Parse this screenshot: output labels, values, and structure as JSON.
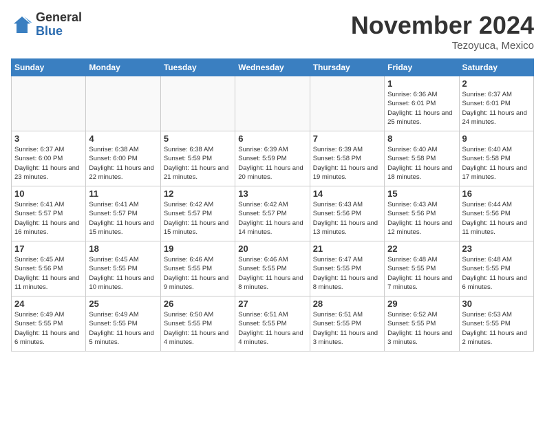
{
  "logo": {
    "general": "General",
    "blue": "Blue"
  },
  "title": "November 2024",
  "location": "Tezoyuca, Mexico",
  "weekdays": [
    "Sunday",
    "Monday",
    "Tuesday",
    "Wednesday",
    "Thursday",
    "Friday",
    "Saturday"
  ],
  "weeks": [
    [
      {
        "day": "",
        "info": ""
      },
      {
        "day": "",
        "info": ""
      },
      {
        "day": "",
        "info": ""
      },
      {
        "day": "",
        "info": ""
      },
      {
        "day": "",
        "info": ""
      },
      {
        "day": "1",
        "info": "Sunrise: 6:36 AM\nSunset: 6:01 PM\nDaylight: 11 hours and 25 minutes."
      },
      {
        "day": "2",
        "info": "Sunrise: 6:37 AM\nSunset: 6:01 PM\nDaylight: 11 hours and 24 minutes."
      }
    ],
    [
      {
        "day": "3",
        "info": "Sunrise: 6:37 AM\nSunset: 6:00 PM\nDaylight: 11 hours and 23 minutes."
      },
      {
        "day": "4",
        "info": "Sunrise: 6:38 AM\nSunset: 6:00 PM\nDaylight: 11 hours and 22 minutes."
      },
      {
        "day": "5",
        "info": "Sunrise: 6:38 AM\nSunset: 5:59 PM\nDaylight: 11 hours and 21 minutes."
      },
      {
        "day": "6",
        "info": "Sunrise: 6:39 AM\nSunset: 5:59 PM\nDaylight: 11 hours and 20 minutes."
      },
      {
        "day": "7",
        "info": "Sunrise: 6:39 AM\nSunset: 5:58 PM\nDaylight: 11 hours and 19 minutes."
      },
      {
        "day": "8",
        "info": "Sunrise: 6:40 AM\nSunset: 5:58 PM\nDaylight: 11 hours and 18 minutes."
      },
      {
        "day": "9",
        "info": "Sunrise: 6:40 AM\nSunset: 5:58 PM\nDaylight: 11 hours and 17 minutes."
      }
    ],
    [
      {
        "day": "10",
        "info": "Sunrise: 6:41 AM\nSunset: 5:57 PM\nDaylight: 11 hours and 16 minutes."
      },
      {
        "day": "11",
        "info": "Sunrise: 6:41 AM\nSunset: 5:57 PM\nDaylight: 11 hours and 15 minutes."
      },
      {
        "day": "12",
        "info": "Sunrise: 6:42 AM\nSunset: 5:57 PM\nDaylight: 11 hours and 15 minutes."
      },
      {
        "day": "13",
        "info": "Sunrise: 6:42 AM\nSunset: 5:57 PM\nDaylight: 11 hours and 14 minutes."
      },
      {
        "day": "14",
        "info": "Sunrise: 6:43 AM\nSunset: 5:56 PM\nDaylight: 11 hours and 13 minutes."
      },
      {
        "day": "15",
        "info": "Sunrise: 6:43 AM\nSunset: 5:56 PM\nDaylight: 11 hours and 12 minutes."
      },
      {
        "day": "16",
        "info": "Sunrise: 6:44 AM\nSunset: 5:56 PM\nDaylight: 11 hours and 11 minutes."
      }
    ],
    [
      {
        "day": "17",
        "info": "Sunrise: 6:45 AM\nSunset: 5:56 PM\nDaylight: 11 hours and 11 minutes."
      },
      {
        "day": "18",
        "info": "Sunrise: 6:45 AM\nSunset: 5:55 PM\nDaylight: 11 hours and 10 minutes."
      },
      {
        "day": "19",
        "info": "Sunrise: 6:46 AM\nSunset: 5:55 PM\nDaylight: 11 hours and 9 minutes."
      },
      {
        "day": "20",
        "info": "Sunrise: 6:46 AM\nSunset: 5:55 PM\nDaylight: 11 hours and 8 minutes."
      },
      {
        "day": "21",
        "info": "Sunrise: 6:47 AM\nSunset: 5:55 PM\nDaylight: 11 hours and 8 minutes."
      },
      {
        "day": "22",
        "info": "Sunrise: 6:48 AM\nSunset: 5:55 PM\nDaylight: 11 hours and 7 minutes."
      },
      {
        "day": "23",
        "info": "Sunrise: 6:48 AM\nSunset: 5:55 PM\nDaylight: 11 hours and 6 minutes."
      }
    ],
    [
      {
        "day": "24",
        "info": "Sunrise: 6:49 AM\nSunset: 5:55 PM\nDaylight: 11 hours and 6 minutes."
      },
      {
        "day": "25",
        "info": "Sunrise: 6:49 AM\nSunset: 5:55 PM\nDaylight: 11 hours and 5 minutes."
      },
      {
        "day": "26",
        "info": "Sunrise: 6:50 AM\nSunset: 5:55 PM\nDaylight: 11 hours and 4 minutes."
      },
      {
        "day": "27",
        "info": "Sunrise: 6:51 AM\nSunset: 5:55 PM\nDaylight: 11 hours and 4 minutes."
      },
      {
        "day": "28",
        "info": "Sunrise: 6:51 AM\nSunset: 5:55 PM\nDaylight: 11 hours and 3 minutes."
      },
      {
        "day": "29",
        "info": "Sunrise: 6:52 AM\nSunset: 5:55 PM\nDaylight: 11 hours and 3 minutes."
      },
      {
        "day": "30",
        "info": "Sunrise: 6:53 AM\nSunset: 5:55 PM\nDaylight: 11 hours and 2 minutes."
      }
    ]
  ]
}
